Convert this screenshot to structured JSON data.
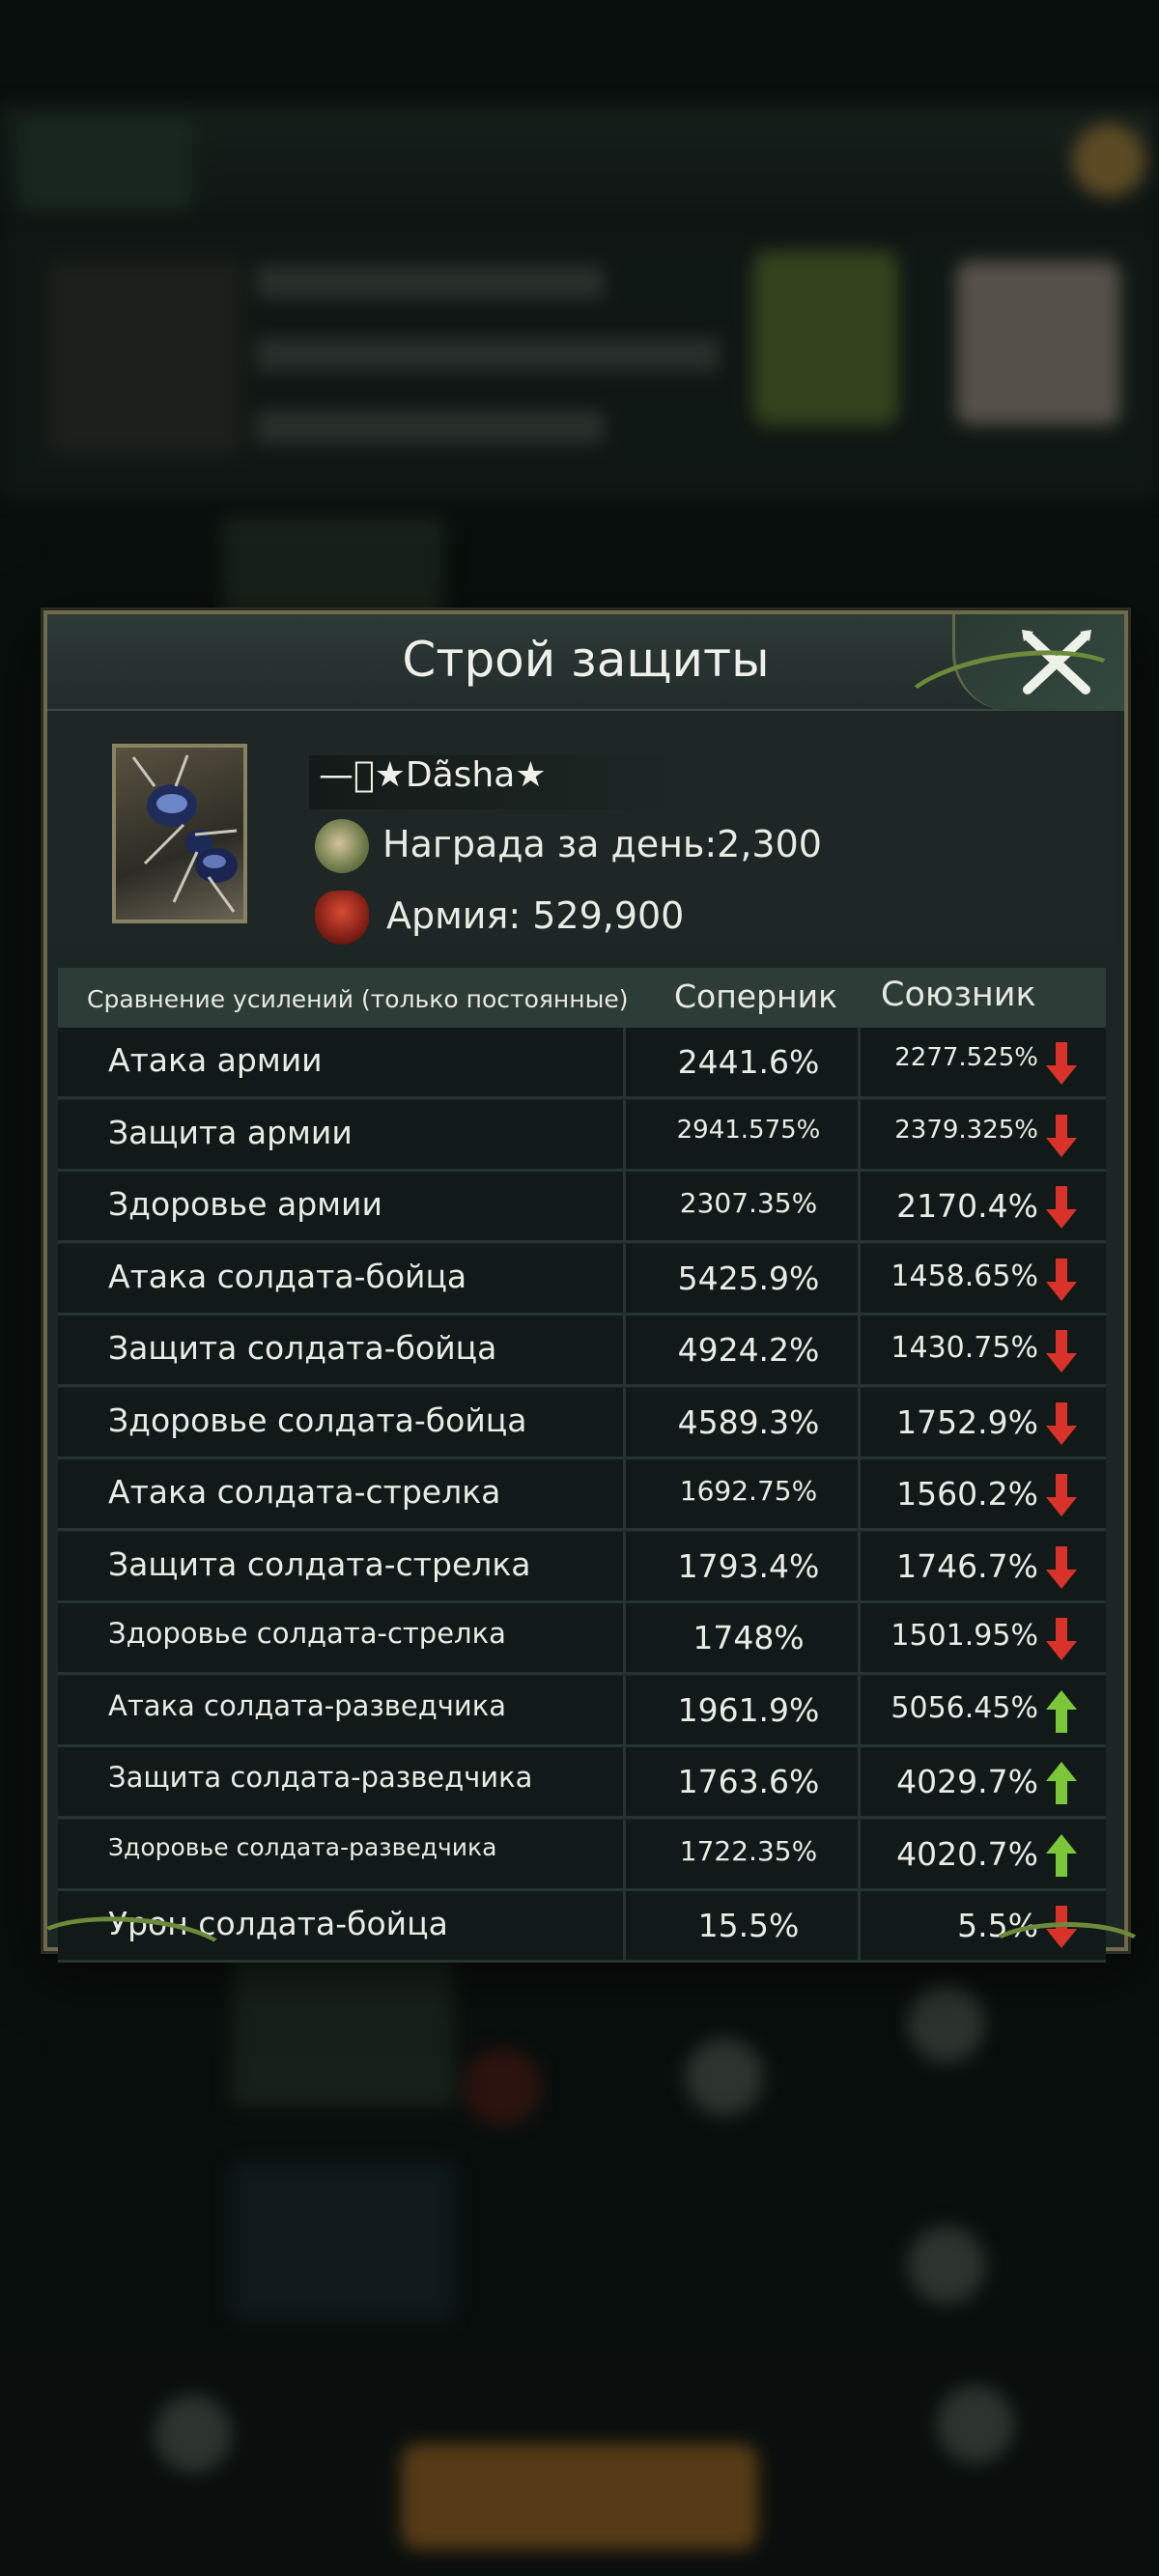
{
  "modal": {
    "title": "Строй защиты"
  },
  "player": {
    "name": "—⃟★Dãsha★",
    "reward_label": "Награда за день:2,300",
    "army_label": "Армия: 529,900"
  },
  "table": {
    "header": {
      "comparison": "Сравнение усилений (только постоянные)",
      "rival": "Соперник",
      "ally": "Союзник"
    },
    "rows": [
      {
        "label": "Атака армии",
        "rival": "2441.6%",
        "ally": "2277.525%",
        "trend": "down"
      },
      {
        "label": "Защита армии",
        "rival": "2941.575%",
        "ally": "2379.325%",
        "trend": "down"
      },
      {
        "label": "Здоровье армии",
        "rival": "2307.35%",
        "ally": "2170.4%",
        "trend": "down"
      },
      {
        "label": "Атака солдата-бойца",
        "rival": "5425.9%",
        "ally": "1458.65%",
        "trend": "down"
      },
      {
        "label": "Защита солдата-бойца",
        "rival": "4924.2%",
        "ally": "1430.75%",
        "trend": "down"
      },
      {
        "label": "Здоровье солдата-бойца",
        "rival": "4589.3%",
        "ally": "1752.9%",
        "trend": "down"
      },
      {
        "label": "Атака солдата-стрелка",
        "rival": "1692.75%",
        "ally": "1560.2%",
        "trend": "down"
      },
      {
        "label": "Защита солдата-стрелка",
        "rival": "1793.4%",
        "ally": "1746.7%",
        "trend": "down"
      },
      {
        "label": "Здоровье солдата-стрелка",
        "rival": "1748%",
        "ally": "1501.95%",
        "trend": "down"
      },
      {
        "label": "Атака солдата-разведчика",
        "rival": "1961.9%",
        "ally": "5056.45%",
        "trend": "up"
      },
      {
        "label": "Защита солдата-разведчика",
        "rival": "1763.6%",
        "ally": "4029.7%",
        "trend": "up"
      },
      {
        "label": "Здоровье солдата-разведчика",
        "rival": "1722.35%",
        "ally": "4020.7%",
        "trend": "up"
      },
      {
        "label": "Урон солдата-бойца",
        "rival": "15.5%",
        "ally": "5.5%",
        "trend": "down"
      }
    ]
  },
  "colors": {
    "arrow_down": "#d8322b",
    "arrow_up": "#7cc63a"
  },
  "icons": {
    "close": "close-icon",
    "reward": "reward-icon",
    "army": "army-icon",
    "avatar": "ant-avatar"
  }
}
